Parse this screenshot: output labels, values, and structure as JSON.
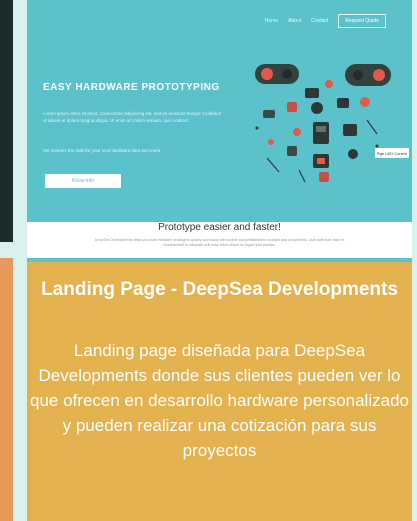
{
  "preview": {
    "nav": {
      "links": [
        "Home",
        "About",
        "Contact"
      ],
      "cta": "Request Quote"
    },
    "hero": {
      "title": "EASY HARDWARE PROTOTYPING",
      "description": "Lorem ipsum dolor sit amet, consectetur adipiscing elit, sed do eiusmod tempor incididunt ut labore et dolore magna aliqua. Ut enim ad minim veniam, quis nostrud.",
      "subtext": "We connect the dots for your next hardware idea and more.",
      "button": "Know info"
    },
    "callout_label": "Rgb LED Control",
    "feature": {
      "title": "Prototype easier and faster!",
      "text": "DeepSea Developments helps you build hardware prototypes quickly and easily with custom and prefabricated modules and components. Duis aute irure dolor in reprehenderit in voluptate velit esse cillum dolore eu fugiat nulla pariatur."
    }
  },
  "caption": {
    "title": "Landing Page - DeepSea Developments",
    "text": "Landing page diseñada para DeepSea Developments donde sus clientes pueden ver lo que ofrecen en desarrollo hardware personalizado y pueden realizar una cotización para sus proyectos"
  },
  "colors": {
    "accent": "#5bc2cc",
    "caption_bg": "#e3b24f",
    "strip_orange": "#e79a5a",
    "strip_dark": "#1e2b2c"
  }
}
